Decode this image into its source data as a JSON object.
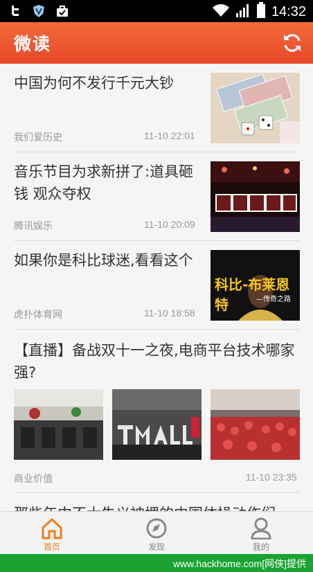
{
  "status_bar": {
    "time": "14:32"
  },
  "app": {
    "title": "微读"
  },
  "feed": [
    {
      "title": "中国为何不发行千元大钞",
      "source": "我们爱历史",
      "time": "11-10 22:01"
    },
    {
      "title": "音乐节目为求新拼了:道具砸钱 观众夺权",
      "source": "腾讯娱乐",
      "time": "11-10 20:09"
    },
    {
      "title": "如果你是科比球迷,看看这个",
      "source": "虎扑体育网",
      "time": "11-10 18:58",
      "image_text": "科比-布莱恩特",
      "image_subtext": "—传奇之路"
    },
    {
      "title": "【直播】备战双十一之夜,电商平台技术哪家强?",
      "source": "商业价值",
      "time": "11-10 23:35"
    },
    {
      "title": "那些年中不大失义被埋的中国体操动作们",
      "source": "",
      "time": ""
    }
  ],
  "tabs": [
    {
      "label": "首页",
      "active": true
    },
    {
      "label": "发现",
      "active": false
    },
    {
      "label": "我的",
      "active": false
    }
  ],
  "watermark": "www.hackhome.com[网侠]提供",
  "colors": {
    "accent": "#f26b3a",
    "tab_active": "#f07c1b",
    "tab_inactive": "#888888"
  }
}
